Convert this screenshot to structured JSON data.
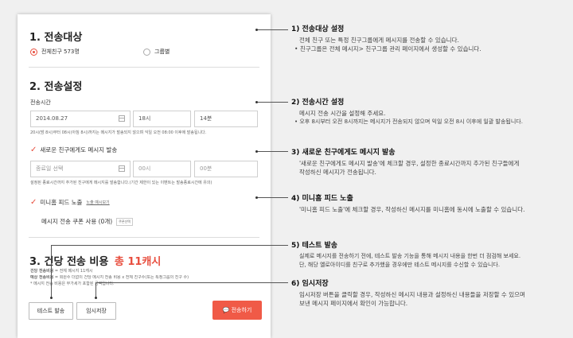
{
  "panel": {
    "section1": {
      "num": "1.",
      "title": "전송대상",
      "radio_all": "전체친구 573명",
      "radio_group": "그룹별"
    },
    "section2": {
      "num": "2.",
      "title": "전송설정",
      "send_time_label": "전송시간",
      "date_value": "2014.08.27",
      "hour_value": "18시",
      "minute_value": "14분",
      "time_help": "20시(밤 8시)부터 08시(아침 8시)까지는 메시지가 발송되지 않으며 익일 오전 08:00 이후에 발송됩니다.",
      "new_friends_label": "새로운 친구에게도 메시지 발송",
      "end_date_placeholder": "종료일 선택",
      "end_hour_value": "00시",
      "end_minute_value": "00분",
      "new_friends_help": "설정된 종료시간까지 추가된 친구에게 메시지를 발송합니다.(기간 제한이 있는 이벤트는 발송종료시간에 유의)",
      "minihome_label": "미니홈 피드 노출",
      "minihome_link": "노출 예시보기",
      "coupon_label": "메시지 전송 쿠폰 사용 (0개)",
      "coupon_button": "쿠폰선택"
    },
    "section3": {
      "num": "3.",
      "title": "건당 전송 비용",
      "cost": "총 11캐시",
      "line1_bold": "건당 전송비용",
      "line1": " = 전체 메시지 11캐시",
      "line2_bold": "예상 전송비용",
      "line2": " = 회원수 더없이 건당 메시지 전송 비용 x 전체 친구수(또는 특정그룹의 친구 수)",
      "line3": "* 메시지 전송 비용은 부가세가 포함된 금액입니다."
    },
    "buttons": {
      "test": "테스트 발송",
      "save": "임시저장",
      "send": "전송하기"
    }
  },
  "notes": [
    {
      "title": "1) 전송대상 설정",
      "lines": [
        "전체 친구 또는 특정 친구그룹에게 메시지를 전송할 수 있습니다."
      ],
      "bullets": [
        "친구그룹은 전체 메시지> 친구그룹 관리 페이지에서 생성할 수 있습니다."
      ]
    },
    {
      "title": "2) 전송시간 설정",
      "lines": [
        "메시지 전송 시간을 설정해 주세요."
      ],
      "bullets": [
        "오후 8시부터 오전 8시까지는 메시지가 전송되지 않으며 익일 오전 8시 이후에 일괄 발송됩니다."
      ]
    },
    {
      "title": "3) 새로운 친구에게도 메시지 발송",
      "lines": [
        "'새로운 친구에게도 메시지 발송'에 체크할 경우, 설정한 종료시간까지 추가된 친구들에게",
        "작성하신 메시지가 전송됩니다."
      ],
      "bullets": []
    },
    {
      "title": "4) 미니홈 피드 노출",
      "lines": [
        "'미니홈 피드 노출'에 체크할 경우, 작성하신 메시지를 미니홈에 동시에 노출할 수 있습니다."
      ],
      "bullets": []
    },
    {
      "title": "5) 테스트 발송",
      "lines": [
        "실제로 메시지를 전송하기 전에, 테스트 발송 기능을 통해 메시지 내용을 한번 더 점검해 보세요.",
        "단, 해당 옐로아이디를 친구로 추가했을 경우에만 테스트 메시지를 수신할 수 있습니다."
      ],
      "bullets": []
    },
    {
      "title": "6) 임시저장",
      "lines": [
        "임시저장 버튼을 클릭할 경우, 작성하신 메시지 내용과 설정하신 내용들을 저장할 수 있으며",
        "보낸 메시지 페이지에서 확인이 가능합니다."
      ],
      "bullets": []
    }
  ],
  "colors": {
    "accent": "#e84e3e",
    "send_button": "#f05a47",
    "background": "#f0f0f0"
  }
}
